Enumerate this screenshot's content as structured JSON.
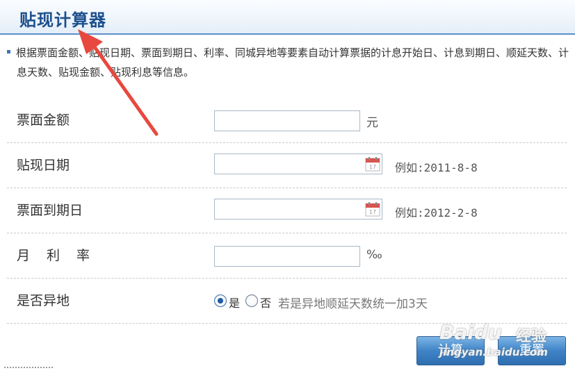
{
  "header": {
    "title": "贴现计算器"
  },
  "description": "根据票面金额、贴现日期、票面到期日、利率、同城异地等要素自动计算票据的计息开始日、计息到期日、顺延天数、计息天数、贴现金额、贴现利息等信息。",
  "fields": {
    "face_amount": {
      "label": "票面金额",
      "value": "",
      "unit": "元"
    },
    "discount_date": {
      "label": "贴现日期",
      "value": "",
      "hint": "例如:2011-8-8"
    },
    "maturity_date": {
      "label": "票面到期日",
      "value": "",
      "hint": "例如:2012-2-8"
    },
    "monthly_rate": {
      "label": "月利率",
      "value": "",
      "unit": "‰"
    },
    "is_remote": {
      "label": "是否异地",
      "options": [
        {
          "label": "是",
          "checked": true
        },
        {
          "label": "否",
          "checked": false
        }
      ],
      "note": "若是异地顺延天数统一加3天"
    }
  },
  "buttons": {
    "calculate": "计算",
    "reset": "重置"
  },
  "watermark": {
    "brand": "Baidu",
    "brand_cn": "经验",
    "url": "jingyan.baidu.com"
  },
  "colors": {
    "accent": "#3f83c6",
    "title": "#1c4f8d",
    "annotation_arrow": "#e8483e"
  },
  "icons": {
    "date_picker": "calendar-icon",
    "annotation": "red-arrow-icon"
  }
}
